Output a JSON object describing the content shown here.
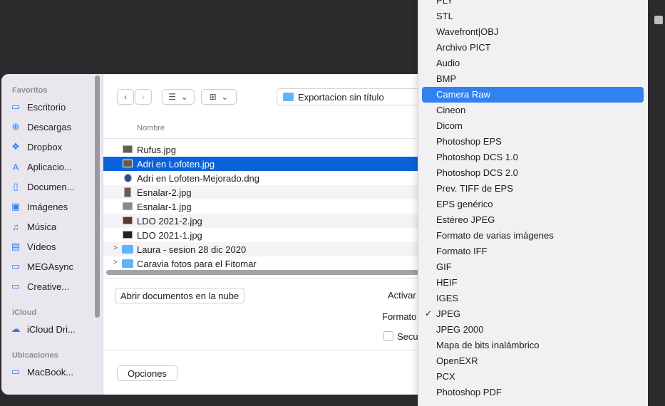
{
  "sidebar": {
    "sections": [
      {
        "title": "Favoritos",
        "items": [
          {
            "label": "Escritorio",
            "icon": "desktop-icon"
          },
          {
            "label": "Descargas",
            "icon": "download-icon"
          },
          {
            "label": "Dropbox",
            "icon": "dropbox-icon"
          },
          {
            "label": "Aplicacio...",
            "icon": "applications-icon"
          },
          {
            "label": "Documen...",
            "icon": "document-icon"
          },
          {
            "label": "Imágenes",
            "icon": "images-icon"
          },
          {
            "label": "Música",
            "icon": "music-icon"
          },
          {
            "label": "Vídeos",
            "icon": "videos-icon"
          },
          {
            "label": "MEGAsync",
            "icon": "folder-icon"
          },
          {
            "label": "Creative...",
            "icon": "folder-icon"
          }
        ]
      },
      {
        "title": "iCloud",
        "items": [
          {
            "label": "iCloud Dri...",
            "icon": "cloud-icon"
          }
        ]
      },
      {
        "title": "Ubicaciones",
        "items": [
          {
            "label": "MacBook...",
            "icon": "laptop-icon"
          }
        ]
      }
    ]
  },
  "toolbar": {
    "back": "‹",
    "forward": "›",
    "list_view": "☰",
    "grid_view": "⊞",
    "chevron": "⌄",
    "folder_name": "Exportacion sin título"
  },
  "file_list": {
    "column_name": "Nombre",
    "files": [
      {
        "name": "Rufus.jpg"
      },
      {
        "name": "Adri en Lofoten.jpg",
        "selected": true
      },
      {
        "name": "Adri en Lofoten-Mejorado.dng"
      },
      {
        "name": "Esnalar-2.jpg"
      },
      {
        "name": "Esnalar-1.jpg"
      },
      {
        "name": "LDO 2021-2.jpg"
      },
      {
        "name": "LDO 2021-1.jpg"
      },
      {
        "name": "Laura - sesion 28 dic 2020",
        "folder": true
      },
      {
        "name": "Caravia fotos para el Fitomar",
        "folder": true
      }
    ]
  },
  "bottom": {
    "cloud_button": "Abrir documentos en la nube",
    "activar_label": "Activar",
    "formato_label": "Formato",
    "secu_label": "Secu",
    "options_button": "Opciones"
  },
  "format_menu": {
    "items": [
      "PLY",
      "STL",
      "Wavefront|OBJ",
      "Archivo PICT",
      "Audio",
      "BMP",
      "Camera Raw",
      "Cineon",
      "Dicom",
      "Photoshop EPS",
      "Photoshop DCS 1.0",
      "Photoshop DCS 2.0",
      "Prev. TIFF de EPS",
      "EPS genérico",
      "Estéreo JPEG",
      "Formato de varias imágenes",
      "Formato IFF",
      "GIF",
      "HEIF",
      "IGES",
      "JPEG",
      "JPEG 2000",
      "Mapa de bits inalámbrico",
      "OpenEXR",
      "PCX",
      "Photoshop PDF"
    ],
    "highlighted": "Camera Raw",
    "checked": "JPEG",
    "check_mark": "✓"
  },
  "colors": {
    "selection": "#0a63d8",
    "menu_highlight": "#2f82f0",
    "folder": "#63b4f5"
  }
}
